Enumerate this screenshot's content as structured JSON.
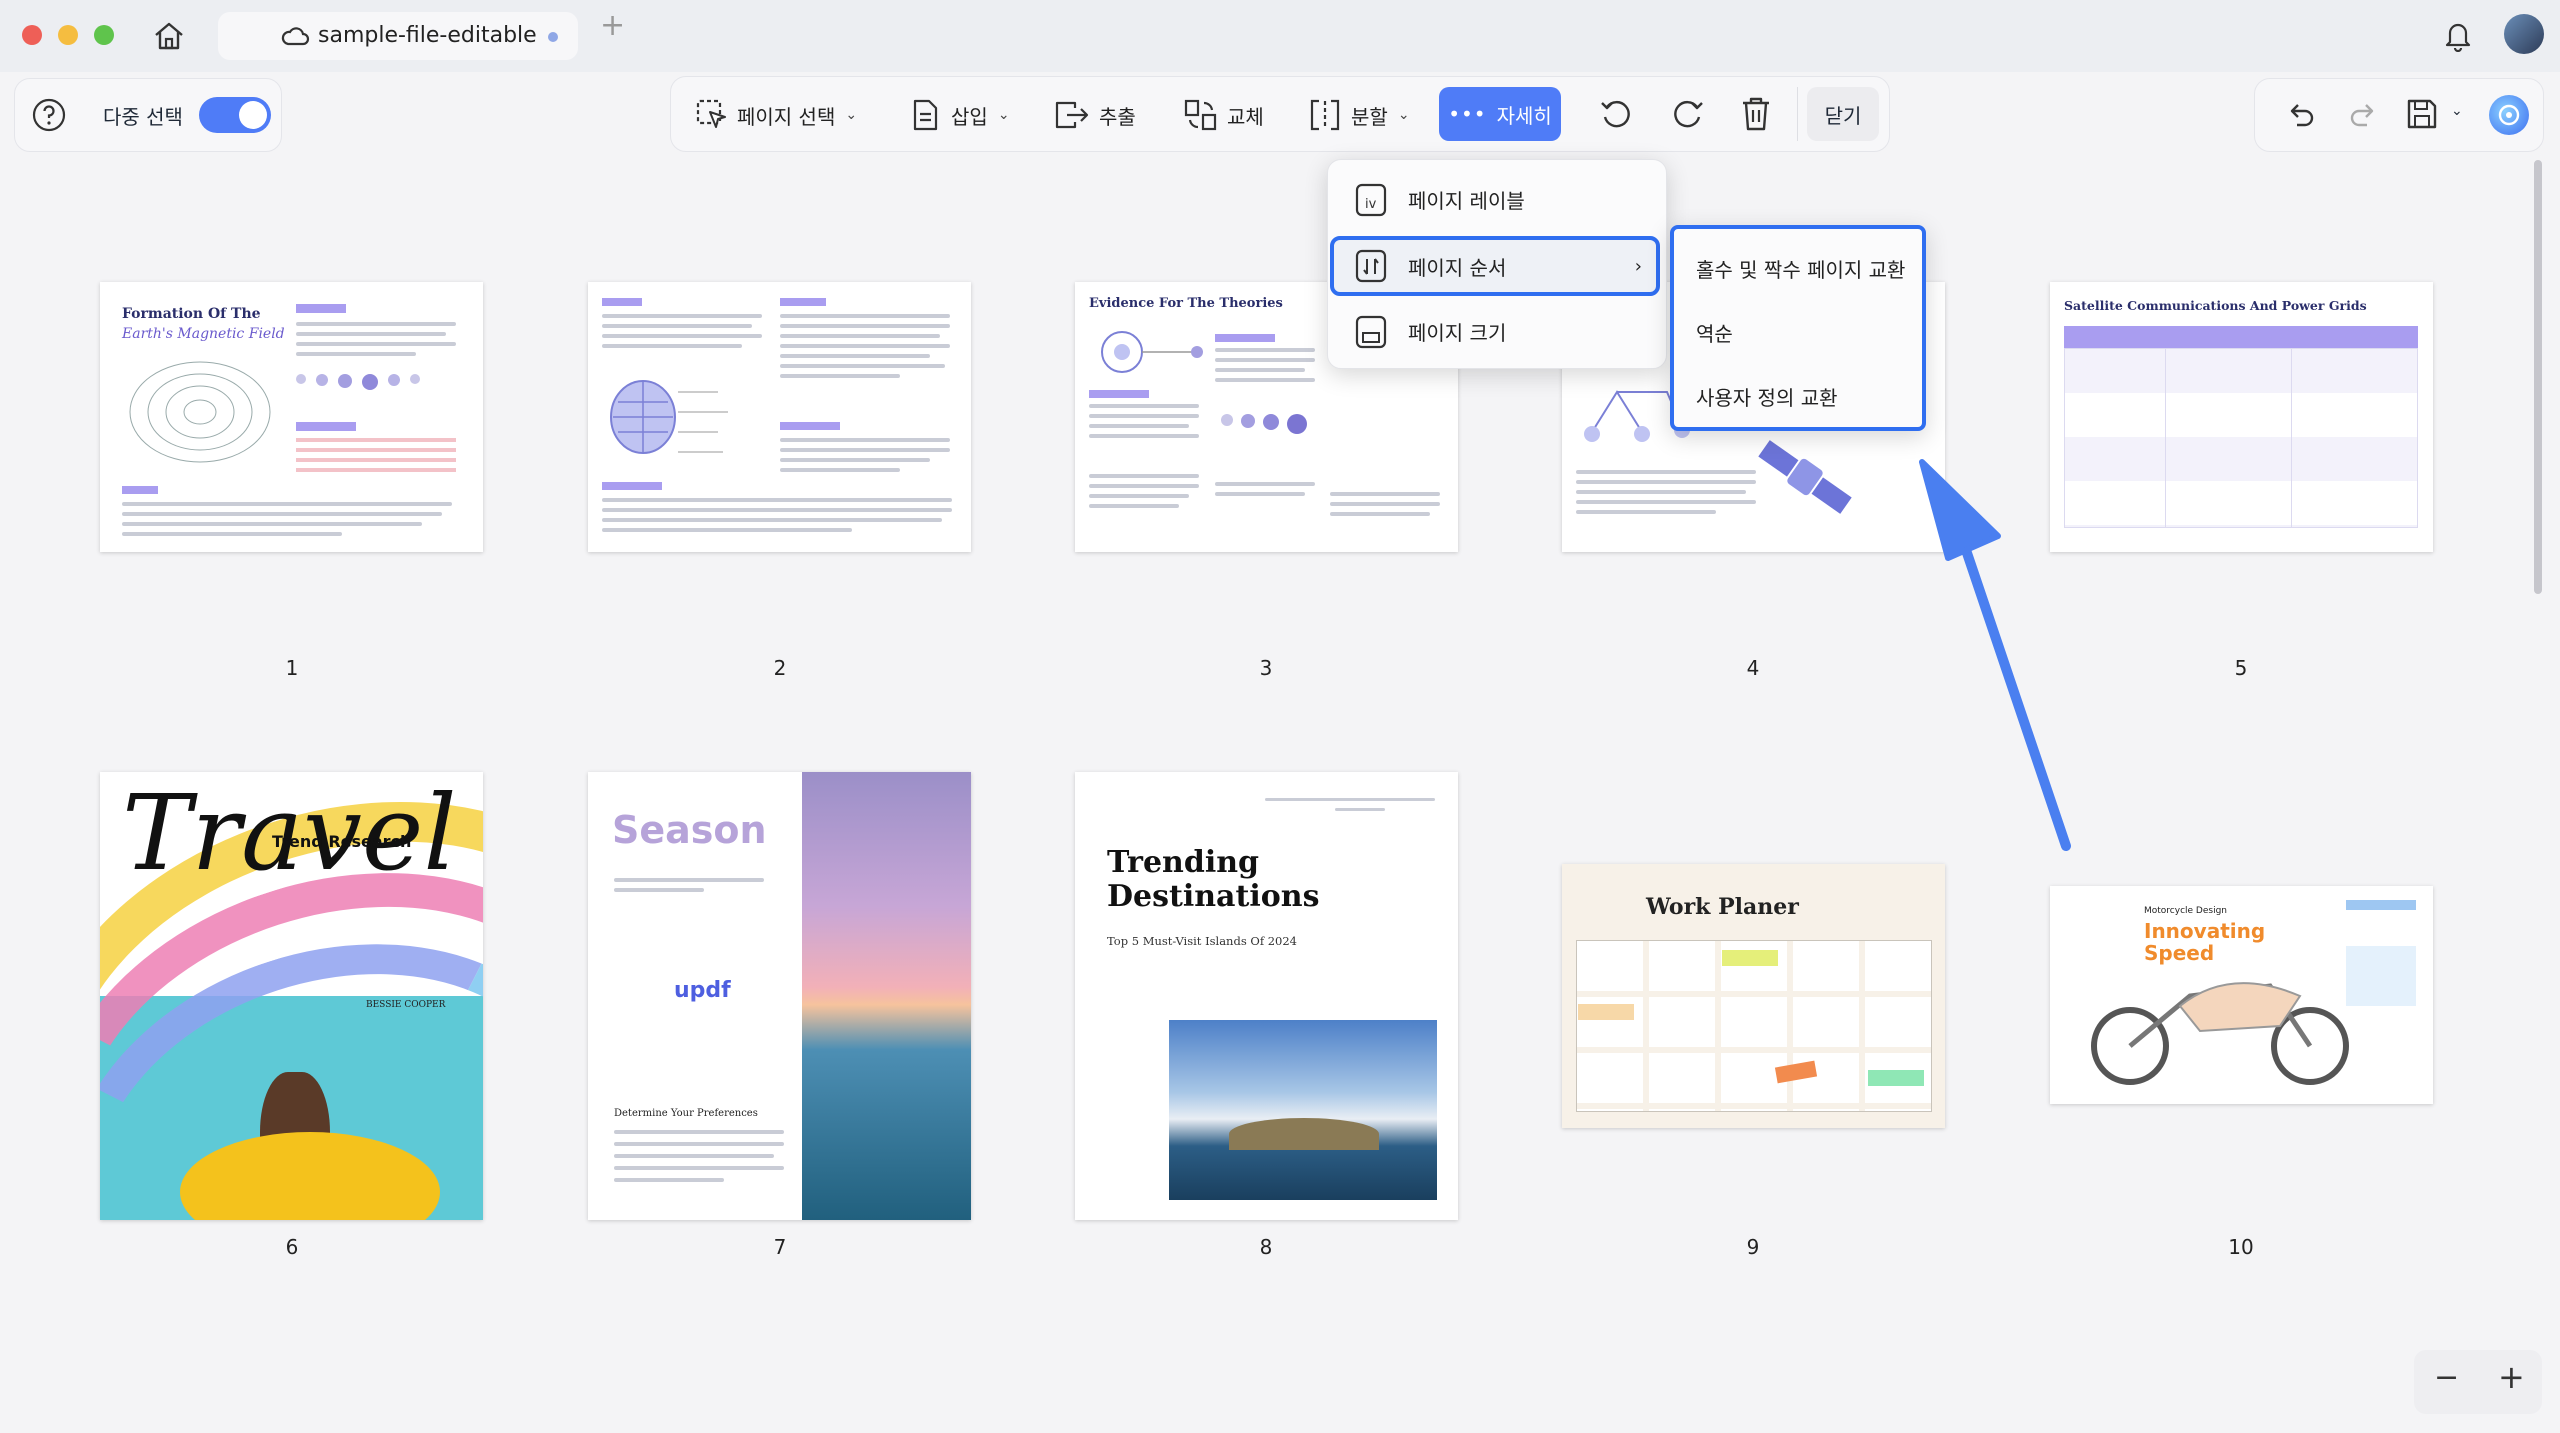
{
  "window": {
    "tab_title": "sample-file-editable",
    "new_tab": "+"
  },
  "left_toolbar": {
    "multi_select_label": "다중 선택",
    "multi_select_on": true
  },
  "toolbar": {
    "page_select": "페이지 선택",
    "insert": "삽입",
    "extract": "추출",
    "replace": "교체",
    "split": "분할",
    "more": "자세히",
    "close": "닫기"
  },
  "more_menu": {
    "items": [
      {
        "label": "페이지 레이블",
        "icon": "page-label-icon"
      },
      {
        "label": "페이지 순서",
        "icon": "page-order-icon"
      },
      {
        "label": "페이지 크기",
        "icon": "page-size-icon"
      }
    ],
    "selected_index": 1
  },
  "submenu": {
    "items": [
      {
        "label": "홀수 및 짝수 페이지 교환"
      },
      {
        "label": "역순"
      },
      {
        "label": "사용자 정의 교환"
      }
    ]
  },
  "pages": [
    {
      "number": "1",
      "title": "Formation Of The",
      "subtitle": "Earth's Magnetic Field"
    },
    {
      "number": "2"
    },
    {
      "number": "3",
      "title": "Evidence For The Theories"
    },
    {
      "number": "4"
    },
    {
      "number": "5",
      "title": "Satellite Communications And Power Grids"
    },
    {
      "number": "6",
      "title": "Travel",
      "subtitle": "Trend Research",
      "author": "BESSIE COOPER"
    },
    {
      "number": "7",
      "title": "Season",
      "brand": "updf",
      "subtitle": "Determine Your Preferences"
    },
    {
      "number": "8",
      "title": "Trending",
      "title2": "Destinations",
      "subtitle": "Top 5 Must-Visit Islands Of 2024"
    },
    {
      "number": "9",
      "title": "Work Planer"
    },
    {
      "number": "10",
      "title": "Motorcycle Design",
      "subtitle": "Innovating",
      "subtitle2": "Speed"
    }
  ],
  "zoom": {
    "minus": "−",
    "plus": "+"
  },
  "colors": {
    "accent": "#3b6ef5",
    "arrow": "#4a7ff0",
    "toggle": "#4f7cf7"
  }
}
